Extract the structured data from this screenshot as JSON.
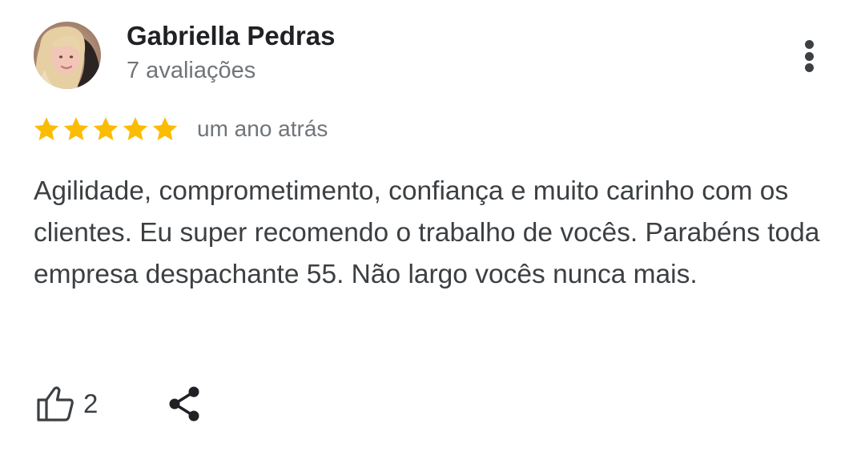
{
  "review": {
    "author_name": "Gabriella Pedras",
    "author_reviews": "7 avaliações",
    "rating": 5,
    "rating_max": 5,
    "date": "um ano atrás",
    "text": "Agilidade, comprometimento, confiança e muito carinho com os clientes. Eu super recomendo o trabalho de vocês. Parabéns toda empresa despachante 55. Não largo vocês nunca mais.",
    "likes": "2"
  },
  "icons": {
    "avatar": "profile-photo",
    "menu": "more-vert-icon",
    "star": "star-icon",
    "like": "thumb-up-outline-icon",
    "share": "share-icon"
  },
  "colors": {
    "star": "#fbbc04",
    "name": "#202124",
    "secondary_text": "#70757a",
    "body_text": "#3c4043"
  }
}
